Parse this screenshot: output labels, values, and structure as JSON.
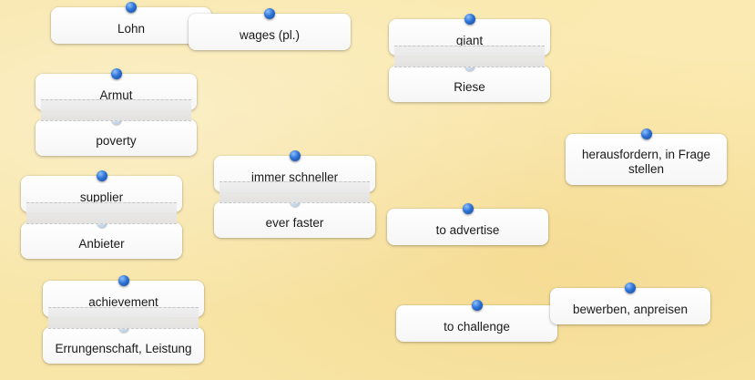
{
  "cards": {
    "lohn": "Lohn",
    "wages": "wages (pl.)",
    "giant": "giant",
    "riese": "Riese",
    "armut": "Armut",
    "poverty": "poverty",
    "herausfordern": "herausfordern, in Frage stellen",
    "supplier": "supplier",
    "anbieter": "Anbieter",
    "immer_schneller": "immer schneller",
    "ever_faster": "ever faster",
    "to_advertise": "to advertise",
    "achievement": "achievement",
    "errungenschaft": "Errungenschaft, Leistung",
    "to_challenge": "to challenge",
    "bewerben": "bewerben, anpreisen"
  },
  "colors": {
    "board_background": "#f8e6a8",
    "card_background": "#ffffff",
    "pin": "#2e74d6",
    "pin_faded": "#c7d7ea",
    "text": "#1a1a1a"
  }
}
